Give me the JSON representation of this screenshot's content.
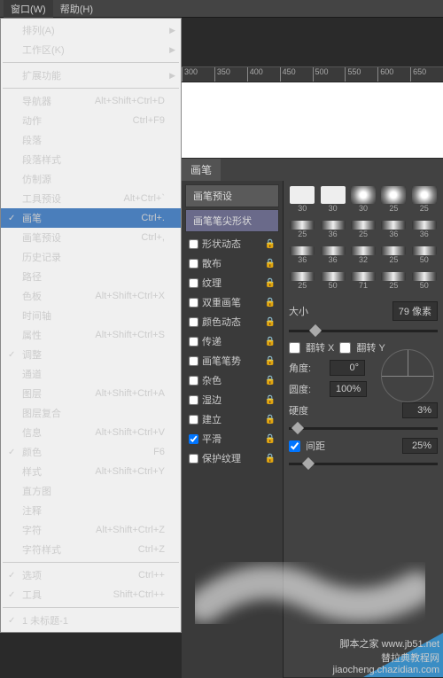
{
  "menubar": {
    "window": "窗口(W)",
    "help": "帮助(H)"
  },
  "menu": {
    "arrange": "排列(A)",
    "workspace": "工作区(K)",
    "extensions": "扩展功能",
    "navigator": "导航器",
    "navigator_sc": "Alt+Shift+Ctrl+D",
    "actions": "动作",
    "actions_sc": "Ctrl+F9",
    "paragraph": "段落",
    "paraStyles": "段落样式",
    "cloneSource": "仿制源",
    "toolPresets": "工具预设",
    "toolPresets_sc": "Alt+Ctrl+`",
    "brush": "画笔",
    "brush_sc": "Ctrl+.",
    "brushPresets": "画笔预设",
    "brushPresets_sc": "Ctrl+,",
    "history": "历史记录",
    "paths": "路径",
    "swatches": "色板",
    "swatches_sc": "Alt+Shift+Ctrl+X",
    "timeline": "时间轴",
    "properties": "属性",
    "properties_sc": "Alt+Shift+Ctrl+S",
    "adjustments": "调整",
    "channels": "通道",
    "layers": "图层",
    "layers_sc": "Alt+Shift+Ctrl+A",
    "layerComps": "图层复合",
    "info": "信息",
    "info_sc": "Alt+Shift+Ctrl+V",
    "color": "颜色",
    "color_sc": "F6",
    "styles": "样式",
    "styles_sc": "Alt+Shift+Ctrl+Y",
    "histogram": "直方图",
    "notes": "注释",
    "character": "字符",
    "character_sc": "Alt+Shift+Ctrl+Z",
    "charStyles": "字符样式",
    "charStyles_sc": "Ctrl+Z",
    "options": "选项",
    "options_sc": "Ctrl++",
    "tools": "工具",
    "tools_sc": "Shift+Ctrl++",
    "doc1": "1 未标题-1"
  },
  "ruler": [
    "300",
    "350",
    "400",
    "450",
    "500",
    "550",
    "600",
    "650"
  ],
  "panel": {
    "tab": "画笔",
    "presetBtn": "画笔预设",
    "tipShape": "画笔笔尖形状",
    "opts": {
      "shapeDynamics": "形状动态",
      "scattering": "散布",
      "texture": "纹理",
      "dualBrush": "双重画笔",
      "colorDynamics": "颜色动态",
      "transfer": "传递",
      "brushPose": "画笔笔势",
      "noise": "杂色",
      "wetEdges": "湿边",
      "buildUp": "建立",
      "smoothing": "平滑",
      "protectTexture": "保护纹理"
    },
    "thumbSizes": [
      "30",
      "30",
      "30",
      "25",
      "25",
      "25",
      "36",
      "25",
      "36",
      "36",
      "36",
      "36",
      "32",
      "25",
      "50",
      "25",
      "50",
      "71",
      "25",
      "50"
    ],
    "size": "大小",
    "sizeVal": "79 像素",
    "flipX": "翻转 X",
    "flipY": "翻转 Y",
    "angle": "角度:",
    "angleVal": "0°",
    "roundness": "圆度:",
    "roundnessVal": "100%",
    "hardness": "硬度",
    "hardnessVal": "3%",
    "spacing": "间距",
    "spacingVal": "25%"
  },
  "watermark": {
    "l1": "脚本之家 www.jb51.net",
    "l2": "替拉典教程网",
    "l3": "jiaocheng.chazidian.com"
  }
}
